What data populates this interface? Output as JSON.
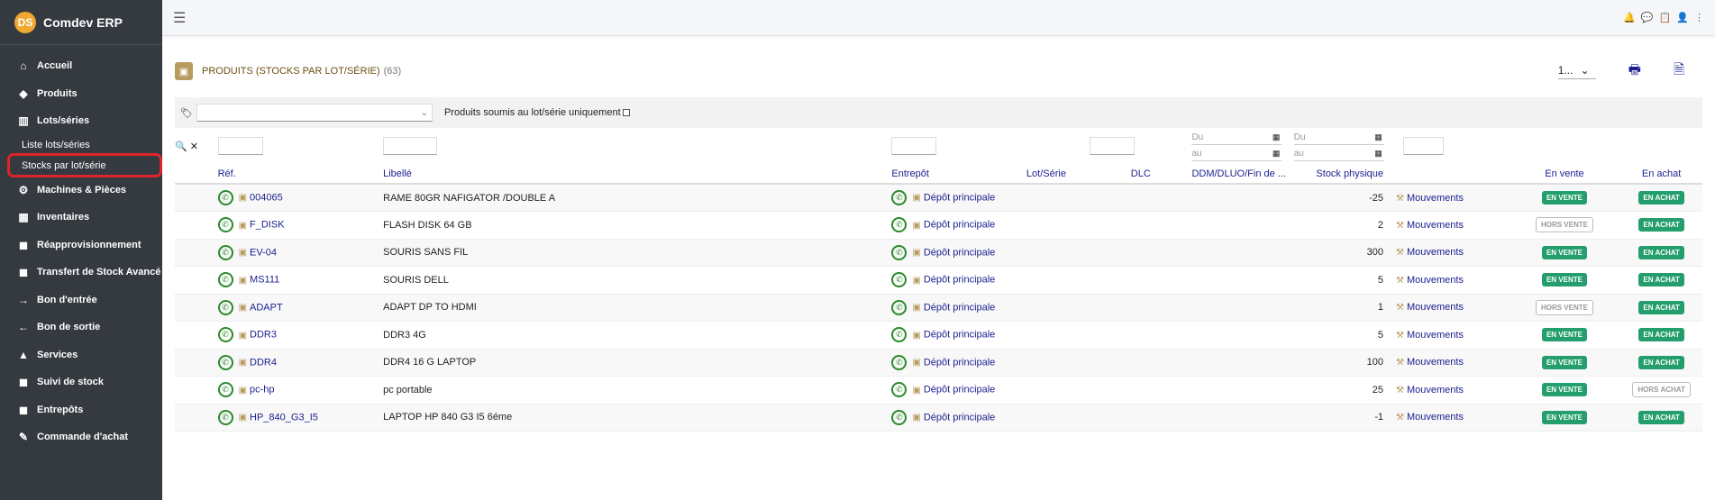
{
  "brand": {
    "logo": "DS",
    "name": "Comdev ERP"
  },
  "sidebar": {
    "items": [
      {
        "label": "Accueil",
        "icon": "home-icon",
        "glyph": "⌂"
      },
      {
        "label": "Produits",
        "icon": "cube-icon",
        "glyph": "◆"
      },
      {
        "label": "Lots/séries",
        "icon": "barcode-icon",
        "glyph": "▥"
      }
    ],
    "subitems": [
      {
        "label": "Liste lots/séries"
      },
      {
        "label": "Stocks par lot/série"
      }
    ],
    "items2": [
      {
        "label": "Machines & Pièces",
        "icon": "cogs-icon",
        "glyph": "⚙"
      },
      {
        "label": "Inventaires",
        "icon": "boxes-icon",
        "glyph": "▦"
      },
      {
        "label": "Réapprovisionnement",
        "icon": "truck-icon",
        "glyph": "◼"
      },
      {
        "label": "Transfert de Stock Avancé",
        "icon": "transfer-icon",
        "glyph": "◼"
      },
      {
        "label": "Bon d'entrée",
        "icon": "arrow-right-icon",
        "glyph": "→"
      },
      {
        "label": "Bon de sortie",
        "icon": "arrow-left-icon",
        "glyph": "←"
      },
      {
        "label": "Services",
        "icon": "services-icon",
        "glyph": "▲"
      },
      {
        "label": "Suivi de stock",
        "icon": "stock-icon",
        "glyph": "◼"
      },
      {
        "label": "Entrepôts",
        "icon": "warehouse-icon",
        "glyph": "◼"
      },
      {
        "label": "Commande d'achat",
        "icon": "cart-icon",
        "glyph": "✎"
      }
    ]
  },
  "page": {
    "title": "PRODUITS (STOCKS PAR LOT/SÉRIE)",
    "count": "(63)",
    "page_size": "1..."
  },
  "filters": {
    "only_lot_label": "Produits soumis au lot/série uniquement",
    "dlc_from": "Du",
    "dlc_to": "au",
    "ddm_from": "Du",
    "ddm_to": "au"
  },
  "columns": {
    "ref": "Réf.",
    "label": "Libellé",
    "warehouse": "Entrepôt",
    "lot": "Lot/Série",
    "dlc": "DLC",
    "ddm": "DDM/DLUO/Fin de ...",
    "stock": "Stock physique",
    "on_sale": "En vente",
    "on_buy": "En achat"
  },
  "rows": [
    {
      "ref": "004065",
      "label": "RAME 80GR NAFIGATOR /DOUBLE A",
      "warehouse": "Dépôt principale",
      "stock": "-25",
      "movements": "Mouvements",
      "sale": "EN VENTE",
      "sale_on": true,
      "buy": "EN ACHAT",
      "buy_on": true
    },
    {
      "ref": "F_DISK",
      "label": "FLASH DISK 64 GB",
      "warehouse": "Dépôt principale",
      "stock": "2",
      "movements": "Mouvements",
      "sale": "HORS VENTE",
      "sale_on": false,
      "buy": "EN ACHAT",
      "buy_on": true
    },
    {
      "ref": "EV-04",
      "label": "SOURIS SANS FIL",
      "warehouse": "Dépôt principale",
      "stock": "300",
      "movements": "Mouvements",
      "sale": "EN VENTE",
      "sale_on": true,
      "buy": "EN ACHAT",
      "buy_on": true
    },
    {
      "ref": "MS111",
      "label": "SOURIS DELL",
      "warehouse": "Dépôt principale",
      "stock": "5",
      "movements": "Mouvements",
      "sale": "EN VENTE",
      "sale_on": true,
      "buy": "EN ACHAT",
      "buy_on": true
    },
    {
      "ref": "ADAPT",
      "label": "ADAPT DP TO HDMI",
      "warehouse": "Dépôt principale",
      "stock": "1",
      "movements": "Mouvements",
      "sale": "HORS VENTE",
      "sale_on": false,
      "buy": "EN ACHAT",
      "buy_on": true
    },
    {
      "ref": "DDR3",
      "label": "DDR3 4G",
      "warehouse": "Dépôt principale",
      "stock": "5",
      "movements": "Mouvements",
      "sale": "EN VENTE",
      "sale_on": true,
      "buy": "EN ACHAT",
      "buy_on": true
    },
    {
      "ref": "DDR4",
      "label": "DDR4 16 G LAPTOP",
      "warehouse": "Dépôt principale",
      "stock": "100",
      "movements": "Mouvements",
      "sale": "EN VENTE",
      "sale_on": true,
      "buy": "EN ACHAT",
      "buy_on": true
    },
    {
      "ref": "pc-hp",
      "label": "pc portable",
      "warehouse": "Dépôt principale",
      "stock": "25",
      "movements": "Mouvements",
      "sale": "EN VENTE",
      "sale_on": true,
      "buy": "HORS ACHAT",
      "buy_on": false
    },
    {
      "ref": "HP_840_G3_I5",
      "label": "LAPTOP HP 840 G3 I5 6éme",
      "warehouse": "Dépôt principale",
      "stock": "-1",
      "movements": "Mouvements",
      "sale": "EN VENTE",
      "sale_on": true,
      "buy": "EN ACHAT",
      "buy_on": true
    }
  ]
}
